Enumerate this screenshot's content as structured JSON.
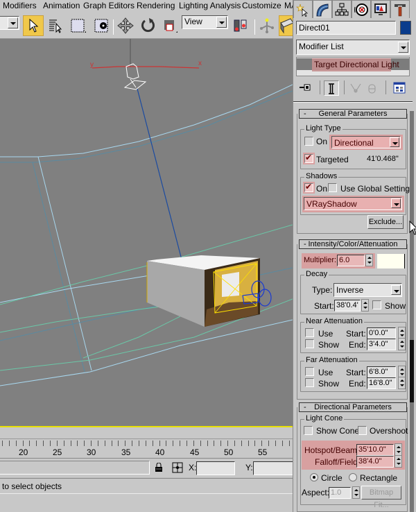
{
  "menu": {
    "items": [
      "Modifiers",
      "Animation",
      "Graph Editors",
      "Rendering",
      "Lighting Analysis",
      "Customize",
      "MA"
    ]
  },
  "toolbar": {
    "reference_coord": "View",
    "icons": [
      "select-object-icon",
      "select-by-name-icon",
      "rectangular-selection-icon",
      "window-crossing-icon",
      "select-and-move-icon",
      "select-and-rotate-icon",
      "select-and-scale-icon",
      "use-pivot-center-icon",
      "select-manipulate-icon",
      "snaps-toggle-icon"
    ]
  },
  "viewport": {
    "axis_x_label": "x",
    "axis_y_label": "y"
  },
  "timeline": {
    "ticks": [
      "20",
      "25",
      "30",
      "35",
      "40",
      "45",
      "50",
      "55"
    ]
  },
  "coords": {
    "x_label": "X:",
    "y_label": "Y:",
    "x_value": "",
    "y_value": ""
  },
  "status": {
    "prompt": "to select objects"
  },
  "panel": {
    "tabs": [
      "create-tab",
      "modify-tab",
      "hierarchy-tab",
      "motion-tab",
      "display-tab",
      "utilities-tab"
    ],
    "object_name": "Direct01",
    "object_color": "#0a3c8c",
    "modifier_list": "Modifier List",
    "stack_item": "Target Directional Light",
    "general": {
      "title": "General Parameters",
      "light_type_label": "Light Type",
      "on_label": "On",
      "on_checked": false,
      "type_value": "Directional",
      "targeted_label": "Targeted",
      "targeted_checked": true,
      "target_distance": "41'0.468\"",
      "shadows_label": "Shadows",
      "shadows_on_label": "On",
      "shadows_on_checked": true,
      "use_global_label": "Use Global Settings",
      "use_global_checked": false,
      "shadow_type": "VRayShadow",
      "exclude_label": "Exclude..."
    },
    "intensity": {
      "title": "Intensity/Color/Attenuation",
      "multiplier_label": "Multiplier:",
      "multiplier_value": "6.0",
      "color": "#fffff0",
      "decay_label": "Decay",
      "type_label": "Type:",
      "type_value": "Inverse",
      "start_label": "Start:",
      "start_value": "38'0.4'",
      "show_label": "Show",
      "near_label": "Near Attenuation",
      "near_use": "Use",
      "near_show": "Show",
      "near_start_label": "Start:",
      "near_start": "0'0.0\"",
      "near_end_label": "End:",
      "near_end": "3'4.0\"",
      "far_label": "Far Attenuation",
      "far_use": "Use",
      "far_show": "Show",
      "far_start_label": "Start:",
      "far_start": "6'8.0\"",
      "far_end_label": "End:",
      "far_end": "16'8.0\""
    },
    "directional": {
      "title": "Directional Parameters",
      "cone_label": "Light Cone",
      "show_cone": "Show Cone",
      "overshoot": "Overshoot",
      "hotspot_label": "Hotspot/Beam:",
      "hotspot_value": "35'10.0\"",
      "falloff_label": "Falloff/Field:",
      "falloff_value": "38'4.0\"",
      "circle_label": "Circle",
      "rectangle_label": "Rectangle",
      "shape_selected": "Circle",
      "aspect_label": "Aspect:",
      "aspect_value": "1.0",
      "bitmap_fit_label": "Bitmap Fit..."
    }
  }
}
